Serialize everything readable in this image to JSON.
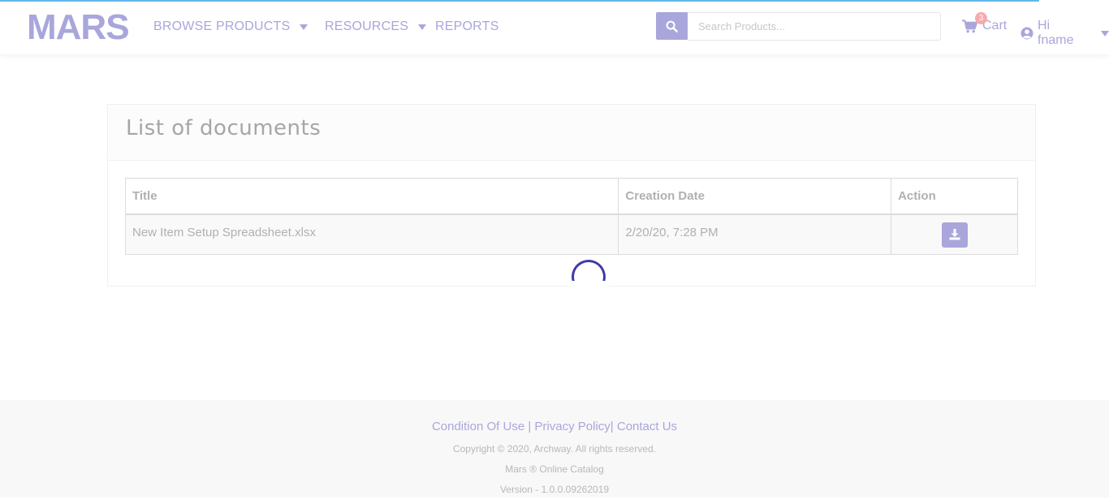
{
  "brand": {
    "logo_text": "MARS",
    "accent_color": "#a9a6dc"
  },
  "nav": {
    "items": [
      {
        "label": "BROWSE PRODUCTS",
        "has_dropdown": true
      },
      {
        "label": "RESOURCES",
        "has_dropdown": true
      },
      {
        "label": "REPORTS",
        "has_dropdown": false
      }
    ]
  },
  "search": {
    "placeholder": "Search Products...",
    "value": "",
    "icon": "search-icon"
  },
  "cart": {
    "label": "Cart",
    "count": "3",
    "icon": "shopping-cart-icon"
  },
  "user": {
    "greeting": "Hi fname",
    "icon": "user-circle-icon"
  },
  "documents": {
    "title": "List of documents",
    "columns": [
      "Title",
      "Creation Date",
      "Action"
    ],
    "rows": [
      {
        "title": "New Item Setup Spreadsheet.xlsx",
        "creation_date": "2/20/20, 7:28 PM",
        "action_icon": "download-icon"
      }
    ],
    "loading": true
  },
  "footer": {
    "links": [
      "Condition Of Use",
      "Privacy Policy",
      "Contact Us"
    ],
    "separator": "|",
    "copyright": "Copyright © 2020, Archway. All rights reserved.",
    "catalog": "Mars ® Online Catalog",
    "version": "Version - 1.0.0.09262019"
  }
}
